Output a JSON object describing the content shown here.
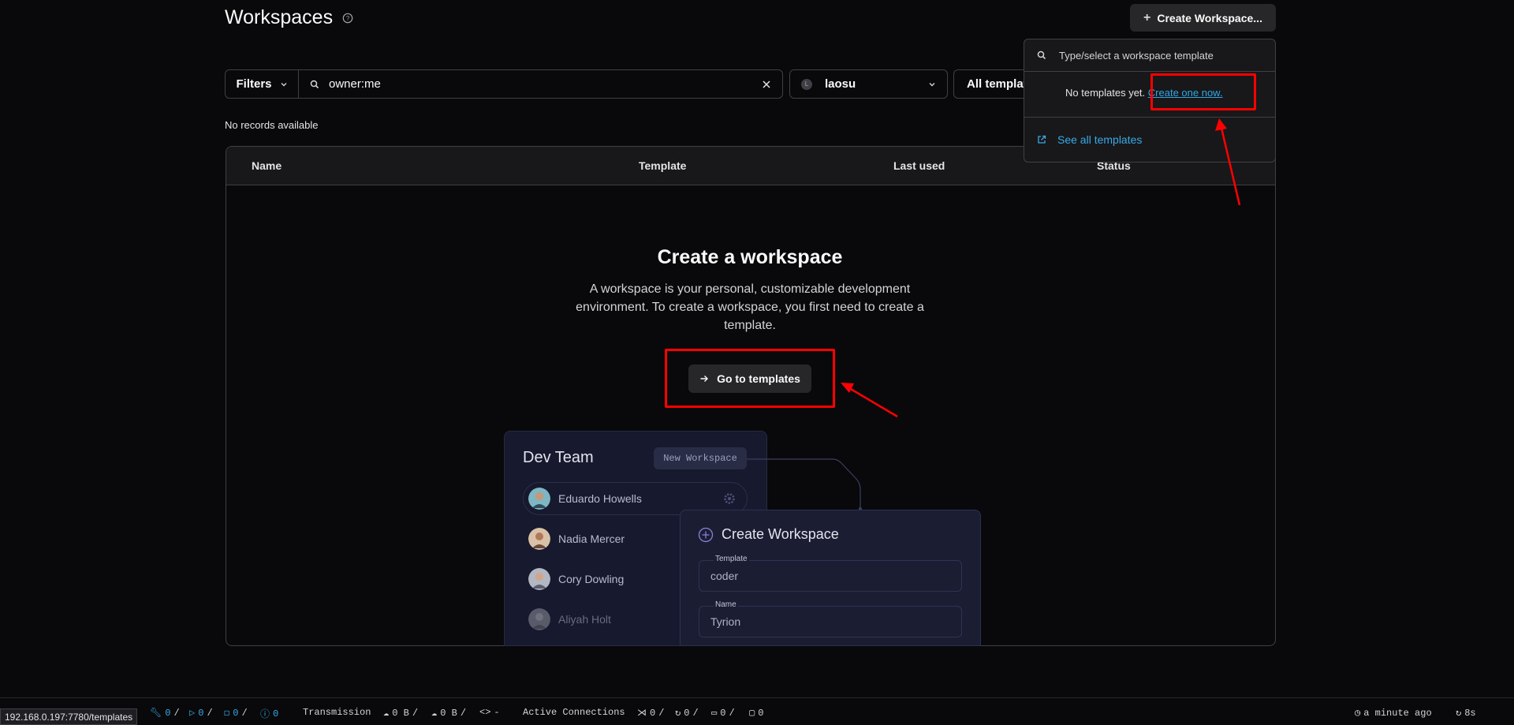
{
  "header": {
    "title": "Workspaces",
    "create_button": "Create Workspace..."
  },
  "filters": {
    "filters_label": "Filters",
    "search_value": "owner:me",
    "user_initial": "L",
    "user_value": "laosu",
    "template_value": "All templat"
  },
  "table": {
    "empty_records": "No records available",
    "columns": [
      "Name",
      "Template",
      "Last used",
      "Status"
    ],
    "empty_title": "Create a workspace",
    "empty_description": "A workspace is your personal, customizable development environment. To create a workspace, you first need to create a template.",
    "goto_button": "Go to templates"
  },
  "illustration": {
    "team_title": "Dev Team",
    "new_workspace_chip": "New Workspace",
    "members": [
      "Eduardo Howells",
      "Nadia Mercer",
      "Cory Dowling",
      "Aliyah Holt"
    ],
    "create_title": "Create Workspace",
    "template_label": "Template",
    "template_value": "coder",
    "name_label": "Name",
    "name_value": "Tyrion"
  },
  "dropdown": {
    "search_placeholder": "Type/select a workspace template",
    "empty_text": "No templates yet.",
    "create_link": "Create one now.",
    "see_all": "See all templates"
  },
  "statusbar": {
    "url": "192.168.0.197:7780/templates",
    "counts": [
      "0",
      "0",
      "0",
      "0"
    ],
    "transmission_label": "Transmission",
    "upload": "0 B",
    "download": "0 B",
    "rate": "-",
    "active_connections_label": "Active Connections",
    "connections": [
      "0",
      "0",
      "0",
      "0"
    ],
    "last_update": "a minute ago",
    "refresh": "8s"
  },
  "colors": {
    "background": "#09090b",
    "accent_link": "#38a9e6",
    "annotation_red": "#ff0000"
  }
}
